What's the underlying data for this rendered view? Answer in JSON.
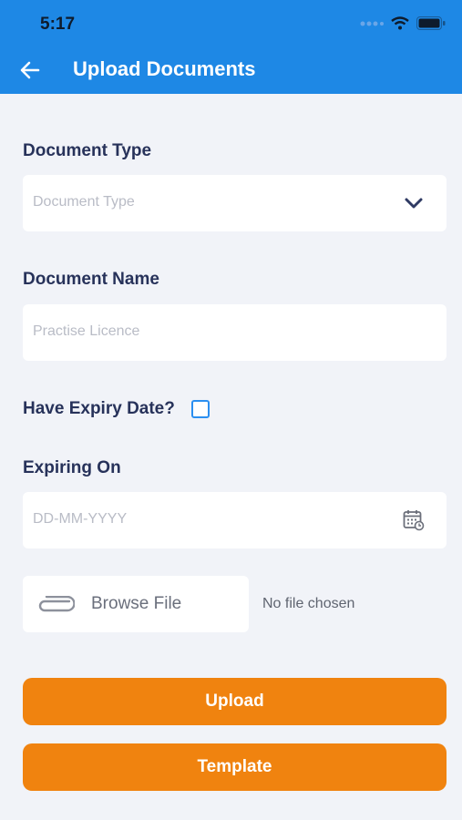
{
  "status_bar": {
    "time": "5:17"
  },
  "app_bar": {
    "title": "Upload Documents"
  },
  "form": {
    "document_type": {
      "label": "Document Type",
      "placeholder": "Document Type"
    },
    "document_name": {
      "label": "Document Name",
      "placeholder": "Practise Licence"
    },
    "expiry": {
      "label": "Have Expiry Date?",
      "checked": false
    },
    "expiring_on": {
      "label": "Expiring On",
      "placeholder": "DD-MM-YYYY"
    },
    "file": {
      "browse_label": "Browse File",
      "status": "No file chosen"
    }
  },
  "actions": {
    "upload_label": "Upload",
    "template_label": "Template"
  },
  "colors": {
    "primary": "#1e88e5",
    "accent": "#f0830f",
    "label": "#27325a",
    "background": "#f1f3f8"
  },
  "icons": [
    "back-arrow-icon",
    "chevron-down-icon",
    "calendar-icon",
    "paperclip-icon",
    "wifi-icon",
    "battery-icon",
    "signal-icon"
  ]
}
